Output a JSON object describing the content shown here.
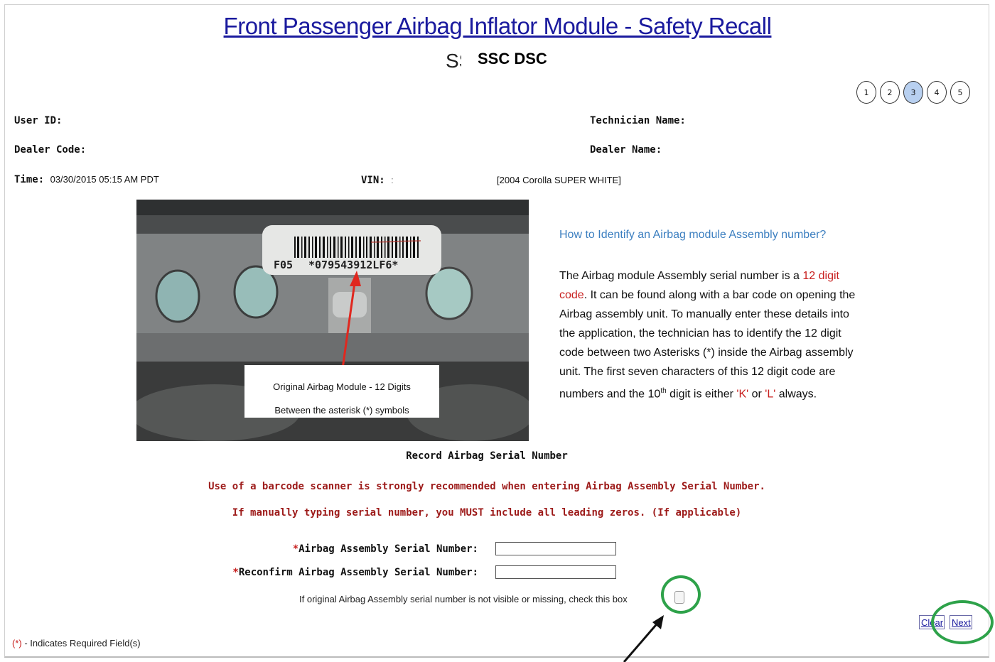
{
  "header": {
    "title": "Front Passenger Airbag Inflator Module - Safety Recall",
    "subtitle_partial": "SS",
    "subtitle": "SSC DSC"
  },
  "steps": [
    {
      "label": "1",
      "active": false
    },
    {
      "label": "2",
      "active": false
    },
    {
      "label": "3",
      "active": true
    },
    {
      "label": "4",
      "active": false
    },
    {
      "label": "5",
      "active": false
    }
  ],
  "info": {
    "user_id_label": "User ID:",
    "dealer_code_label": "Dealer Code:",
    "time_label": "Time:",
    "time_value": "03/30/2015 05:15 AM PDT",
    "vin_label": "VIN:",
    "vin_value": ":",
    "vehicle_value": "[2004 Corolla SUPER WHITE]",
    "technician_label": "Technician Name:",
    "dealer_name_label": "Dealer Name:"
  },
  "photo": {
    "label_prefix": "F05",
    "barcode_text": "*079543912LF6*",
    "callout_line1": "Original Airbag Module - 12 Digits",
    "callout_line2": "Between the asterisk (*) symbols"
  },
  "help": {
    "heading": "How to Identify an Airbag module Assembly number?",
    "p1": "The Airbag module Assembly serial number is a ",
    "p1_red": "12 digit code",
    "p2": ". It can be found along with a bar code on opening the Airbag assembly unit. To manually enter these details into the application, the technician has to identify the 12 digit code between two Asterisks (*) inside the Airbag assembly unit. The first seven characters of this 12 digit code are numbers and the 10",
    "p2_sup": "th",
    "p3": " digit is either ",
    "p3_k": "'K'",
    "p3_or": " or ",
    "p3_l": "'L'",
    "p3_end": " always."
  },
  "record": {
    "title": "Record Airbag Serial Number",
    "warning1": "Use of a barcode scanner is strongly recommended when entering Airbag Assembly Serial Number.",
    "warning2": "If manually typing serial number, you MUST include all leading zeros. (If applicable)",
    "asterisk": "*",
    "serial_label": "Airbag Assembly Serial Number:",
    "serial_value": "",
    "reconfirm_label": "Reconfirm Airbag Assembly Serial Number:",
    "reconfirm_value": "",
    "missing_text": "If original Airbag Assembly serial number is not visible or missing, check this box"
  },
  "buttons": {
    "clear": "Clear",
    "next": "Next"
  },
  "footer": {
    "req_star": "(*)",
    "req_text": " - Indicates Required Field(s)"
  },
  "colors": {
    "title_link": "#1a1a9e",
    "warning_red": "#9d1b1a",
    "help_blue": "#3c7fc0",
    "highlight_green": "#2ea24a",
    "active_step": "#b8d0f0"
  }
}
